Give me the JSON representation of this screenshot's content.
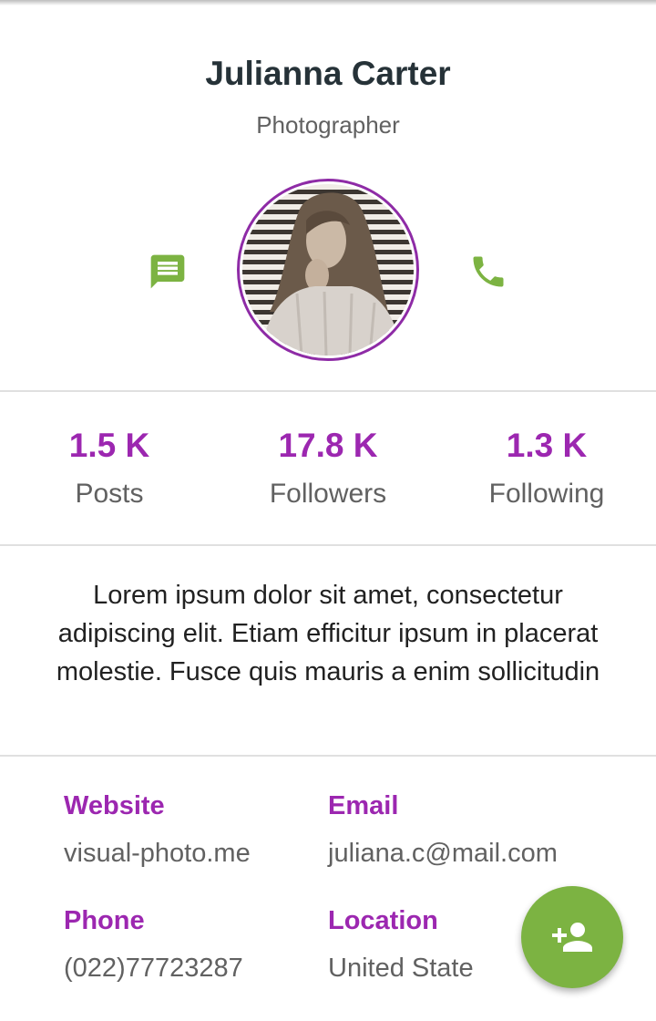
{
  "profile": {
    "name": "Julianna Carter",
    "role": "Photographer"
  },
  "actions": {
    "message_icon": "message-icon",
    "call_icon": "phone-icon",
    "fab_icon": "person-add-icon"
  },
  "stats": [
    {
      "value": "1.5 K",
      "label": "Posts"
    },
    {
      "value": "17.8 K",
      "label": "Followers"
    },
    {
      "value": "1.3 K",
      "label": "Following"
    }
  ],
  "bio": "Lorem ipsum dolor sit amet, consectetur adipiscing elit. Etiam efficitur ipsum in placerat molestie. Fusce quis mauris a enim sollicitudin",
  "details": {
    "website": {
      "label": "Website",
      "value": "visual-photo.me"
    },
    "email": {
      "label": "Email",
      "value": "juliana.c@mail.com"
    },
    "phone": {
      "label": "Phone",
      "value": "(022)77723287"
    },
    "location": {
      "label": "Location",
      "value": "United State"
    }
  },
  "colors": {
    "accent": "#9c27b0",
    "green": "#7cb342",
    "avatar_ring": "#8e2ba6",
    "text_dark": "#263238",
    "text_muted": "#616161"
  }
}
